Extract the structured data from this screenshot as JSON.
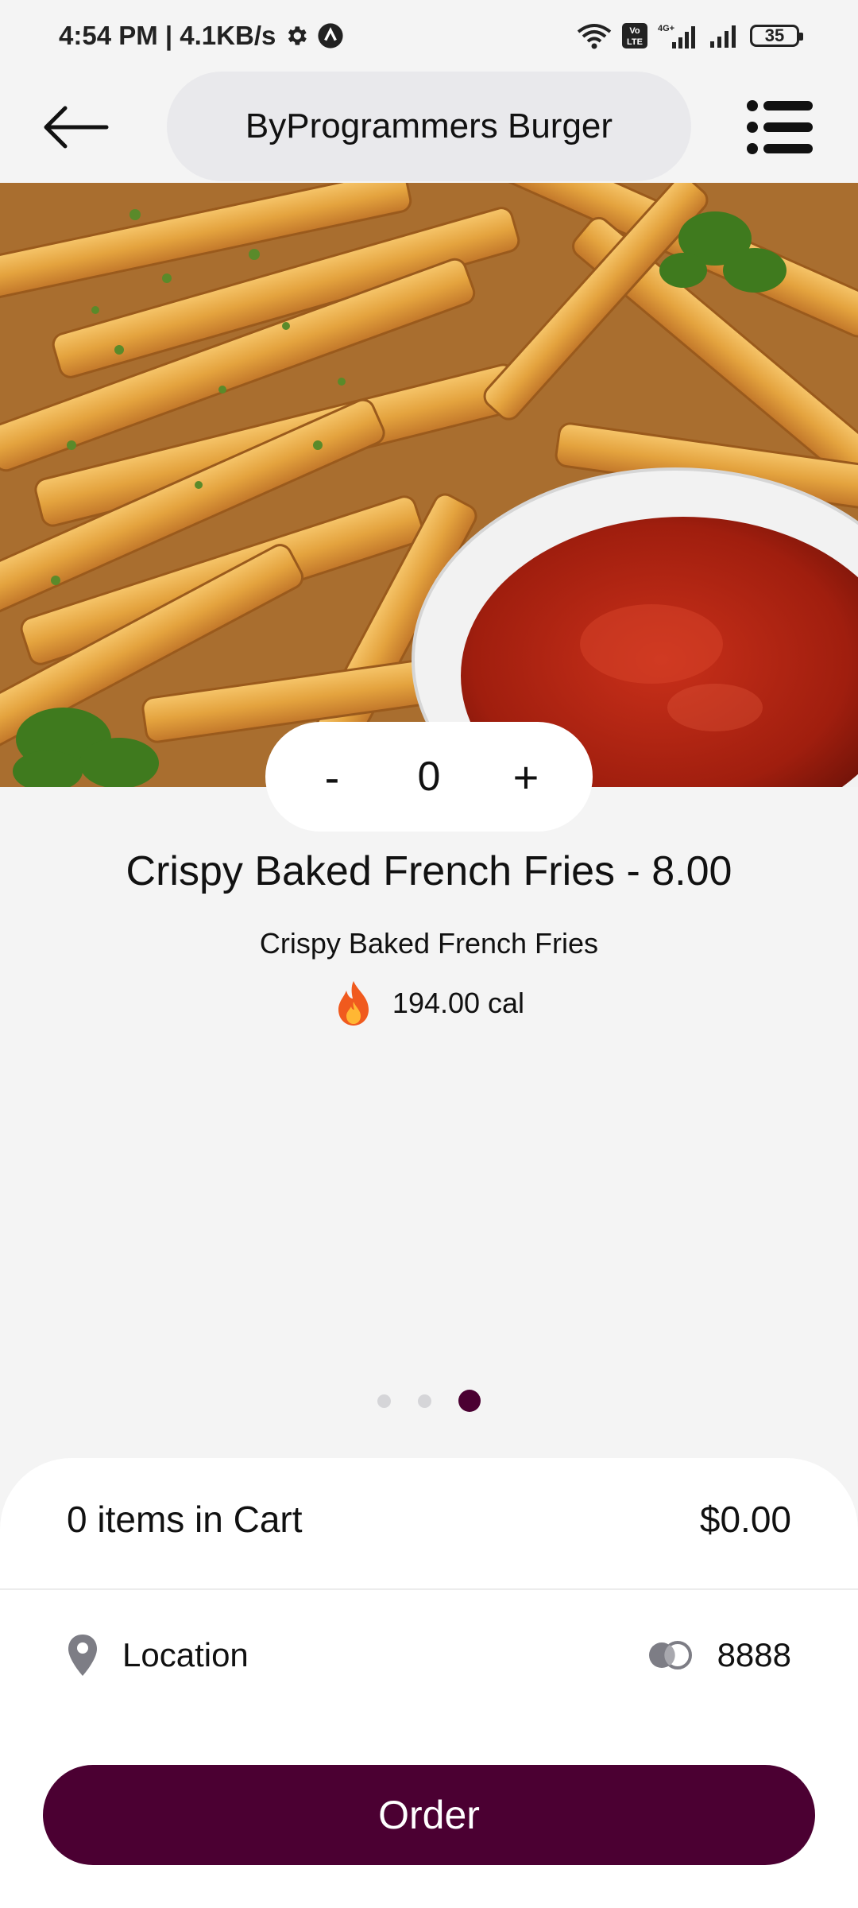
{
  "status_bar": {
    "time_speed": "4:54 PM | 4.1KB/s",
    "network": "4G+",
    "battery": "35"
  },
  "header": {
    "title": "ByProgrammers Burger"
  },
  "stepper": {
    "minus_label": "-",
    "quantity": "0",
    "plus_label": "+"
  },
  "product": {
    "title": "Crispy Baked French Fries - 8.00",
    "description": "Crispy Baked French Fries",
    "calories": "194.00 cal"
  },
  "pager": {
    "total": 3,
    "active_index": 2
  },
  "cart": {
    "items_label": "0 items in Cart",
    "total": "$0.00"
  },
  "location": {
    "label": "Location",
    "card_number": "8888"
  },
  "order_button": {
    "label": "Order"
  },
  "colors": {
    "accent": "#4b0032",
    "background": "#f4f4f4",
    "title_pill": "#e9e9ec"
  }
}
